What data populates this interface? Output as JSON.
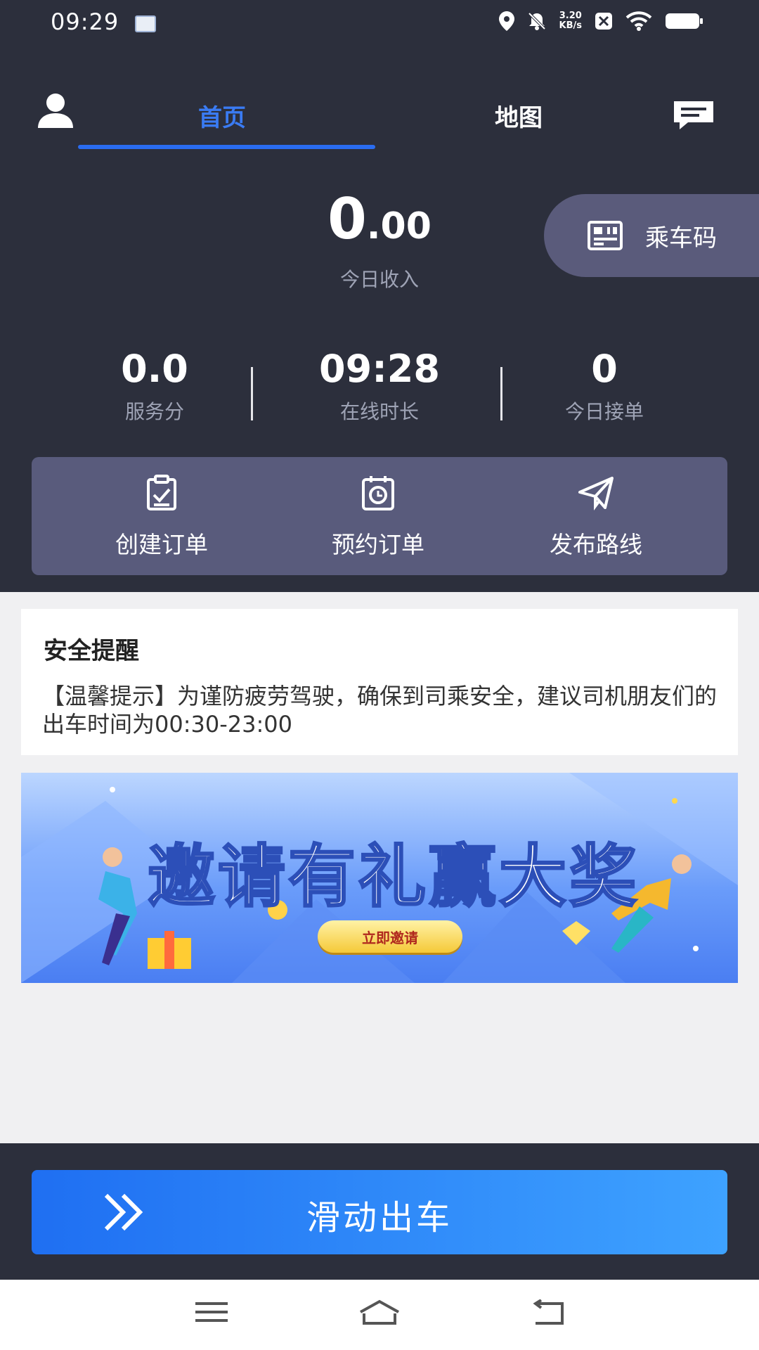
{
  "status_bar": {
    "time": "09:29",
    "net_speed_value": "3.20",
    "net_speed_unit": "KB/s",
    "icons": [
      "app-thumbnail-icon",
      "location-icon",
      "mute-bell-icon",
      "x-app-icon",
      "wifi-icon",
      "battery-icon"
    ]
  },
  "nav": {
    "tabs": [
      {
        "label": "首页",
        "active": true
      },
      {
        "label": "地图",
        "active": false
      }
    ],
    "icons": [
      "user-icon",
      "message-icon"
    ]
  },
  "hero": {
    "income_int": "0",
    "income_dec": ".00",
    "income_label": "今日收入",
    "ride_code_label": "乘车码"
  },
  "stats": [
    {
      "value": "0.0",
      "label": "服务分"
    },
    {
      "value": "09:28",
      "label": "在线时长"
    },
    {
      "value": "0",
      "label": "今日接单"
    }
  ],
  "actions": [
    {
      "label": "创建订单",
      "icon": "clipboard-check-icon"
    },
    {
      "label": "预约订单",
      "icon": "calendar-clock-icon"
    },
    {
      "label": "发布路线",
      "icon": "paper-plane-icon"
    }
  ],
  "safety": {
    "title": "安全提醒",
    "body": "【温馨提示】为谨防疲劳驾驶，确保到司乘安全，建议司机朋友们的出车时间为00:30-23:00"
  },
  "banner": {
    "title": "邀请有礼赢大奖",
    "button": "立即邀请"
  },
  "slide": {
    "label": "滑动出车"
  },
  "colors": {
    "dark_bg": "#2c2f3c",
    "accent_blue": "#2a6cf0",
    "panel": "#595b7c"
  }
}
